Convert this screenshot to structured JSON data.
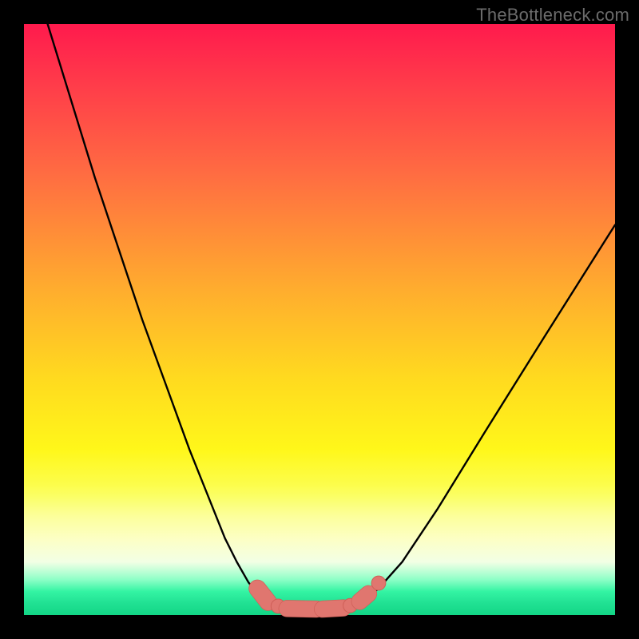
{
  "watermark": "TheBottleneck.com",
  "colors": {
    "frame": "#000000",
    "curve": "#000000",
    "marker_fill": "#e0766f",
    "marker_stroke": "#cf5f58"
  },
  "chart_data": {
    "type": "line",
    "title": "",
    "xlabel": "",
    "ylabel": "",
    "xlim": [
      0,
      100
    ],
    "ylim": [
      0,
      100
    ],
    "grid": false,
    "legend": false,
    "series": [
      {
        "name": "left-branch",
        "x": [
          4,
          8,
          12,
          16,
          20,
          24,
          28,
          32,
          34,
          36,
          38,
          40,
          41
        ],
        "y": [
          100,
          87,
          74,
          62,
          50,
          39,
          28,
          18,
          13,
          9,
          5.5,
          3,
          2
        ]
      },
      {
        "name": "bottom",
        "x": [
          41,
          44,
          48,
          52,
          55,
          57
        ],
        "y": [
          2,
          1.2,
          1,
          1,
          1.3,
          2
        ]
      },
      {
        "name": "right-branch",
        "x": [
          57,
          60,
          64,
          70,
          78,
          88,
          100
        ],
        "y": [
          2,
          4.5,
          9,
          18,
          31,
          47,
          66
        ]
      }
    ],
    "markers": [
      {
        "kind": "pill",
        "x1": 39.5,
        "y1": 4.5,
        "x2": 41.3,
        "y2": 2.2,
        "r": 1.4
      },
      {
        "kind": "dot",
        "cx": 43.0,
        "cy": 1.5,
        "r": 1.2
      },
      {
        "kind": "pill",
        "x1": 44.5,
        "y1": 1.1,
        "x2": 49.5,
        "y2": 1.0,
        "r": 1.35
      },
      {
        "kind": "pill",
        "x1": 50.5,
        "y1": 1.0,
        "x2": 54.0,
        "y2": 1.2,
        "r": 1.35
      },
      {
        "kind": "dot",
        "cx": 55.2,
        "cy": 1.6,
        "r": 1.2
      },
      {
        "kind": "pill",
        "x1": 56.8,
        "y1": 2.3,
        "x2": 58.3,
        "y2": 3.6,
        "r": 1.35
      },
      {
        "kind": "dot",
        "cx": 60.0,
        "cy": 5.4,
        "r": 1.2
      }
    ]
  }
}
